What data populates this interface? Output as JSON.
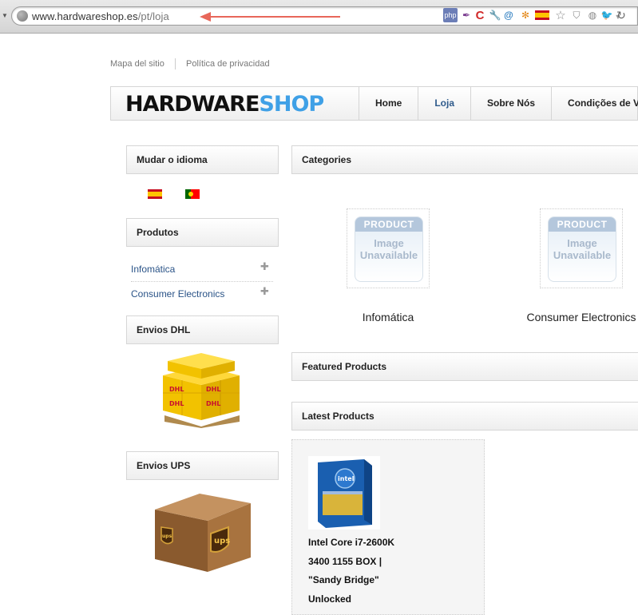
{
  "browser": {
    "url_host": "www.hardwareshop.es",
    "url_path": "/pt/loja",
    "extension_icons": [
      "php-icon",
      "feather-icon",
      "c-icon",
      "wrench-icon",
      "swirl-icon",
      "joomla-icon",
      "spain-flag-icon",
      "star-icon",
      "shield-icon",
      "twitter-icon",
      "dropdown-icon",
      "reload-icon"
    ],
    "extension_labels": {
      "php": "php"
    }
  },
  "toplinks": [
    "Mapa del sitio",
    "Política de privacidad"
  ],
  "logo": {
    "part1": "HARDWARE",
    "part2": "SHOP"
  },
  "nav": [
    "Home",
    "Loja",
    "Sobre Nós",
    "Condições de Ve"
  ],
  "sidebar": {
    "language_title": "Mudar o idioma",
    "products_title": "Produtos",
    "categories": [
      "Infomática",
      "Consumer Electronics"
    ],
    "dhl_title": "Envios DHL",
    "ups_title": "Envios UPS",
    "dhl_brand": "DHL",
    "ups_brand": "ups"
  },
  "main": {
    "categories_title": "Categories",
    "category_items": [
      "Infomática",
      "Consumer Electronics"
    ],
    "placeholder": {
      "top": "PRODUCT",
      "line1": "Image",
      "line2": "Unavailable"
    },
    "featured_title": "Featured Products",
    "latest_title": "Latest Products",
    "latest_product": {
      "lines": [
        "Intel Core i7-2600K",
        "3400 1155 BOX |",
        "\"Sandy Bridge\"",
        "Unlocked"
      ],
      "box_brand": "intel"
    }
  },
  "colors": {
    "link": "#2a5387",
    "logo_accent": "#3fa0e6",
    "active_nav": "#2e5a8b"
  }
}
